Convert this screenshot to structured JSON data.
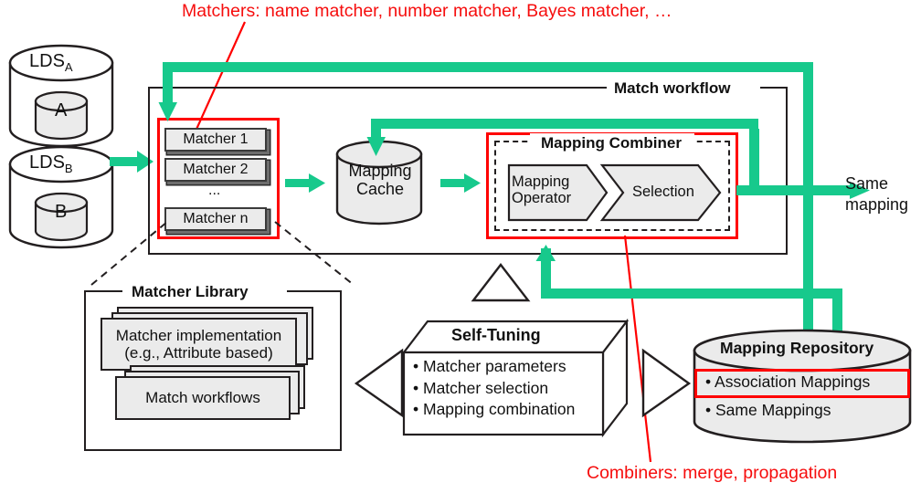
{
  "annotations": {
    "matchers_note": "Matchers: name matcher, number matcher, Bayes matcher, …",
    "combiners_note": "Combiners: merge, propagation"
  },
  "sources": [
    {
      "outer_label": "LDS",
      "outer_sub": "A",
      "inner_label": "A"
    },
    {
      "outer_label": "LDS",
      "outer_sub": "B",
      "inner_label": "B"
    }
  ],
  "match_workflow": {
    "title": "Match workflow",
    "matcher_group": {
      "items": [
        "Matcher 1",
        "Matcher 2",
        "Matcher n"
      ],
      "ellipsis": "..."
    },
    "mapping_cache": {
      "line1": "Mapping",
      "line2": "Cache"
    },
    "mapping_combiner": {
      "title": "Mapping Combiner",
      "stage1_line1": "Mapping",
      "stage1_line2": "Operator",
      "stage2": "Selection"
    }
  },
  "output": {
    "line1": "Same",
    "line2": "mapping"
  },
  "matcher_library": {
    "title": "Matcher Library",
    "card1_line1": "Matcher implementation",
    "card1_line2": "(e.g., Attribute based)",
    "card2": "Match workflows"
  },
  "self_tuning": {
    "title": "Self-Tuning",
    "bullets": [
      "• Matcher parameters",
      "• Matcher selection",
      "• Mapping combination"
    ]
  },
  "mapping_repository": {
    "title": "Mapping Repository",
    "rows": [
      "• Association Mappings",
      "• Same Mappings"
    ]
  },
  "colors": {
    "flow_green": "#17c98c",
    "annotation_red": "#ff0000",
    "outline": "#231f20",
    "fill_gray": "#ebebeb"
  }
}
